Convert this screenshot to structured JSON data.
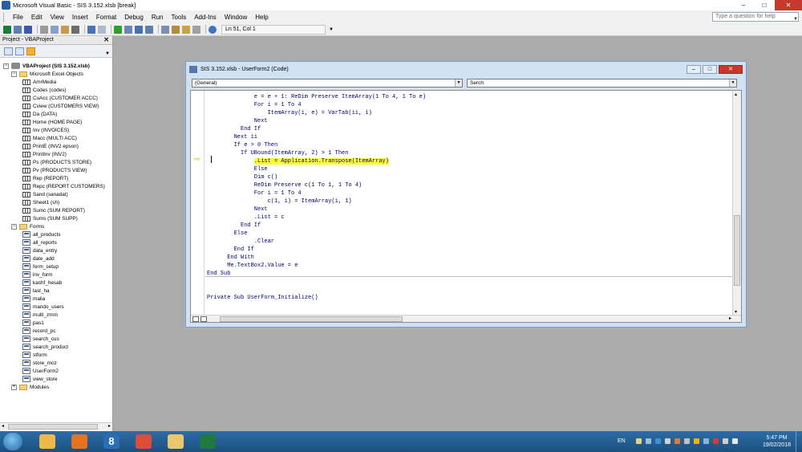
{
  "window": {
    "title": "Microsoft Visual Basic - SIS 3.152.xlsb [break]",
    "minimize": "–",
    "maximize": "□",
    "close": "✕"
  },
  "menu": {
    "items": [
      "File",
      "Edit",
      "View",
      "Insert",
      "Format",
      "Debug",
      "Run",
      "Tools",
      "Add-Ins",
      "Window",
      "Help"
    ],
    "help_placeholder": "Type a question for help"
  },
  "toolbar": {
    "position": "Ln 51, Col 1"
  },
  "project": {
    "title": "Project - VBAProject",
    "close": "✕",
    "tree": [
      {
        "label": "VBAProject (SIS 3.152.xlsb)",
        "level": 0,
        "kind": "project",
        "expander": "−",
        "bold": true
      },
      {
        "label": "Microsoft Excel Objects",
        "level": 1,
        "kind": "folder",
        "expander": "−"
      },
      {
        "label": "AmrMedia",
        "level": 2,
        "kind": "sheet"
      },
      {
        "label": "Codes (codes)",
        "level": 2,
        "kind": "sheet"
      },
      {
        "label": "CuAcc (CUSTOMER ACCC)",
        "level": 2,
        "kind": "sheet"
      },
      {
        "label": "Cview (CUSTOMERS VIEW)",
        "level": 2,
        "kind": "sheet"
      },
      {
        "label": "Da (DATA)",
        "level": 2,
        "kind": "sheet"
      },
      {
        "label": "Home (HOME PAGE)",
        "level": 2,
        "kind": "sheet"
      },
      {
        "label": "Inv (INVOICES)",
        "level": 2,
        "kind": "sheet"
      },
      {
        "label": "Macc (MULTI ACC)",
        "level": 2,
        "kind": "sheet"
      },
      {
        "label": "PrintE (INV2 epson)",
        "level": 2,
        "kind": "sheet"
      },
      {
        "label": "PrintInv (INV2)",
        "level": 2,
        "kind": "sheet"
      },
      {
        "label": "Ps (PRODUCTS STORE)",
        "level": 2,
        "kind": "sheet"
      },
      {
        "label": "Pv (PRODUCTS VIEW)",
        "level": 2,
        "kind": "sheet"
      },
      {
        "label": "Rep (REPORT)",
        "level": 2,
        "kind": "sheet"
      },
      {
        "label": "Repc (REPORT CUSTOMERS)",
        "level": 2,
        "kind": "sheet"
      },
      {
        "label": "Sand (sanadat)",
        "level": 2,
        "kind": "sheet"
      },
      {
        "label": "Sheet1 (sh)",
        "level": 2,
        "kind": "sheet"
      },
      {
        "label": "Sumc (SUM REPORT)",
        "level": 2,
        "kind": "sheet"
      },
      {
        "label": "Sums (SUM SUPP)",
        "level": 2,
        "kind": "sheet"
      },
      {
        "label": "Forms",
        "level": 1,
        "kind": "folder",
        "expander": "−"
      },
      {
        "label": "all_products",
        "level": 2,
        "kind": "form"
      },
      {
        "label": "all_reports",
        "level": 2,
        "kind": "form"
      },
      {
        "label": "data_entry",
        "level": 2,
        "kind": "form"
      },
      {
        "label": "date_add",
        "level": 2,
        "kind": "form"
      },
      {
        "label": "form_setup",
        "level": 2,
        "kind": "form"
      },
      {
        "label": "inv_form",
        "level": 2,
        "kind": "form"
      },
      {
        "label": "kashf_hesab",
        "level": 2,
        "kind": "form"
      },
      {
        "label": "last_ha",
        "level": 2,
        "kind": "form"
      },
      {
        "label": "malia",
        "level": 2,
        "kind": "form"
      },
      {
        "label": "mando_users",
        "level": 2,
        "kind": "form"
      },
      {
        "label": "multi_zmm",
        "level": 2,
        "kind": "form"
      },
      {
        "label": "pas1",
        "level": 2,
        "kind": "form"
      },
      {
        "label": "record_pc",
        "level": 2,
        "kind": "form"
      },
      {
        "label": "search_cus",
        "level": 2,
        "kind": "form"
      },
      {
        "label": "search_product",
        "level": 2,
        "kind": "form"
      },
      {
        "label": "stform",
        "level": 2,
        "kind": "form"
      },
      {
        "label": "store_moz",
        "level": 2,
        "kind": "form"
      },
      {
        "label": "UserForm2",
        "level": 2,
        "kind": "form"
      },
      {
        "label": "view_store",
        "level": 2,
        "kind": "form"
      },
      {
        "label": "Modules",
        "level": 1,
        "kind": "folder",
        "expander": "+"
      }
    ]
  },
  "code_window": {
    "title": "SIS 3.152.xlsb - UserForm2 (Code)",
    "object_combo": "(General)",
    "proc_combo": "Serch",
    "execution_marker": "⇨",
    "lines": [
      {
        "indent": 14,
        "text": "e = e + 1: ReDim Preserve ItemArray(1 To 4, 1 To e)"
      },
      {
        "indent": 14,
        "text": "For i = 1 To 4"
      },
      {
        "indent": 18,
        "text": "ItemArray(i, e) = VarTab(ii, i)"
      },
      {
        "indent": 14,
        "text": "Next"
      },
      {
        "indent": 10,
        "text": "End If"
      },
      {
        "indent": 8,
        "text": "Next ii"
      },
      {
        "indent": 8,
        "text": "If e > 0 Then"
      },
      {
        "indent": 10,
        "text": "If UBound(ItemArray, 2) > 1 Then"
      },
      {
        "indent": 14,
        "text": ".List = Application.Transpose(ItemArray)",
        "highlight": true
      },
      {
        "indent": 14,
        "text": "Else"
      },
      {
        "indent": 14,
        "text": "Dim c()"
      },
      {
        "indent": 14,
        "text": "ReDim Preserve c(1 To 1, 1 To 4)"
      },
      {
        "indent": 14,
        "text": "For i = 1 To 4"
      },
      {
        "indent": 18,
        "text": "c(1, i) = ItemArray(i, 1)"
      },
      {
        "indent": 14,
        "text": "Next"
      },
      {
        "indent": 14,
        "text": ".List = c"
      },
      {
        "indent": 10,
        "text": "End If"
      },
      {
        "indent": 8,
        "text": "Else"
      },
      {
        "indent": 14,
        "text": ".Clear"
      },
      {
        "indent": 8,
        "text": "End If"
      },
      {
        "indent": 6,
        "text": "End With"
      },
      {
        "indent": 6,
        "text": "Me.TextBox2.Value = e"
      },
      {
        "indent": 0,
        "text": "End Sub"
      },
      {
        "indent": 0,
        "text": ""
      },
      {
        "indent": 0,
        "text": ""
      },
      {
        "indent": 0,
        "text": "Private Sub UserForm_Initialize()"
      }
    ]
  },
  "taskbar": {
    "apps": [
      {
        "name": "outlook",
        "color": "#f0b848"
      },
      {
        "name": "media-player",
        "color": "#e8731e"
      },
      {
        "name": "windows-8-app",
        "color": "#2a6fb5",
        "label": "8"
      },
      {
        "name": "chrome",
        "color": "#dd4b39"
      },
      {
        "name": "file-explorer",
        "color": "#e9c86a"
      },
      {
        "name": "excel",
        "color": "#1f7a40"
      }
    ],
    "language": "EN",
    "time": "5:47 PM",
    "date": "19/02/2018"
  },
  "colors": {
    "code_keyword": "#00007a",
    "highlight": "#ffff33",
    "titlebar_close": "#c7392c",
    "taskbar": "#2d6da6"
  }
}
